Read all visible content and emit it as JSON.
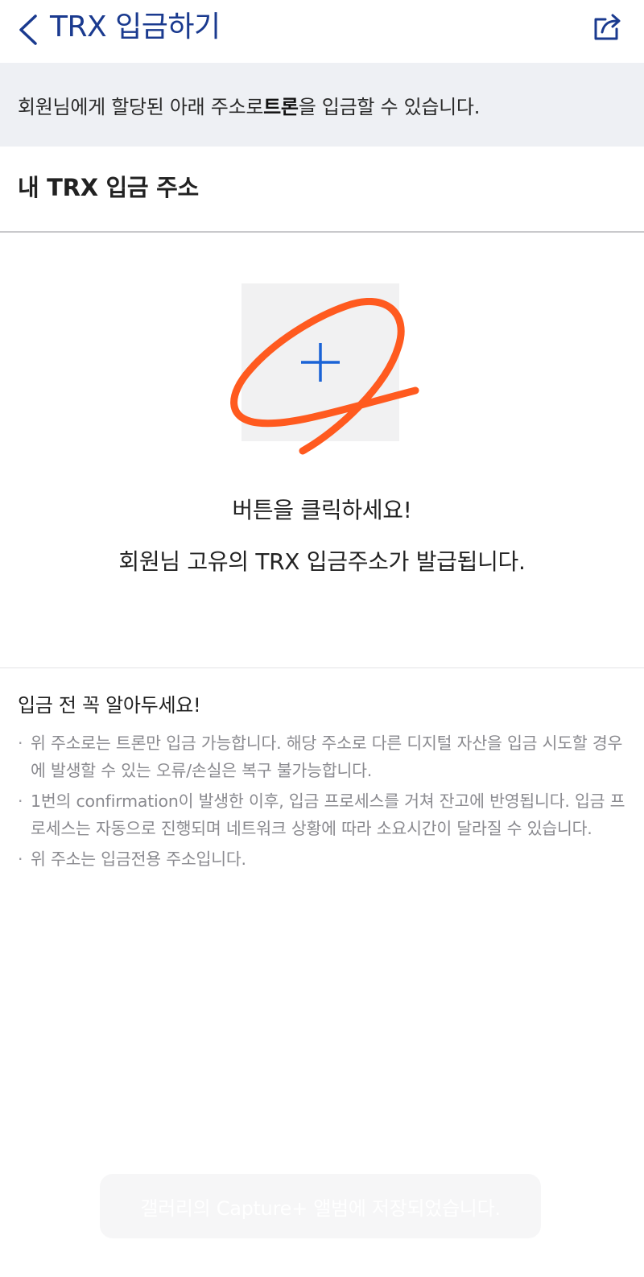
{
  "header": {
    "title": "TRX 입금하기"
  },
  "notice": {
    "prefix": "회원님에게 할당된 아래 주소로 ",
    "highlight": "트론",
    "suffix": "을 입금할 수 있습니다."
  },
  "section": {
    "title": "내 TRX 입금 주소"
  },
  "add_area": {
    "prompt_line1": "버튼을 클릭하세요!",
    "prompt_line2": "회원님 고유의 TRX 입금주소가 발급됩니다."
  },
  "notes": {
    "title": "입금 전 꼭 알아두세요!",
    "items": [
      "위 주소로는 트론만 입금 가능합니다. 해당 주소로 다른 디지털 자산을 입금 시도할 경우에 발생할 수 있는 오류/손실은 복구 불가능합니다.",
      "1번의 confirmation이 발생한 이후, 입금 프로세스를 거쳐 잔고에 반영됩니다. 입금 프로세스는 자동으로 진행되며 네트워크 상황에 따라 소요시간이 달라질 수 있습니다.",
      "위 주소는 입금전용 주소입니다."
    ]
  },
  "toast": {
    "text": "갤러리의 Capture+ 앨범에 저장되었습니다."
  },
  "colors": {
    "title_blue": "#1a3a8f",
    "plus_blue": "#1a63d6",
    "annotation_orange": "#ff5a1f",
    "notice_bg": "#eef0f4"
  },
  "icons": {
    "back": "chevron-left-icon",
    "share": "share-icon",
    "add": "plus-icon"
  }
}
